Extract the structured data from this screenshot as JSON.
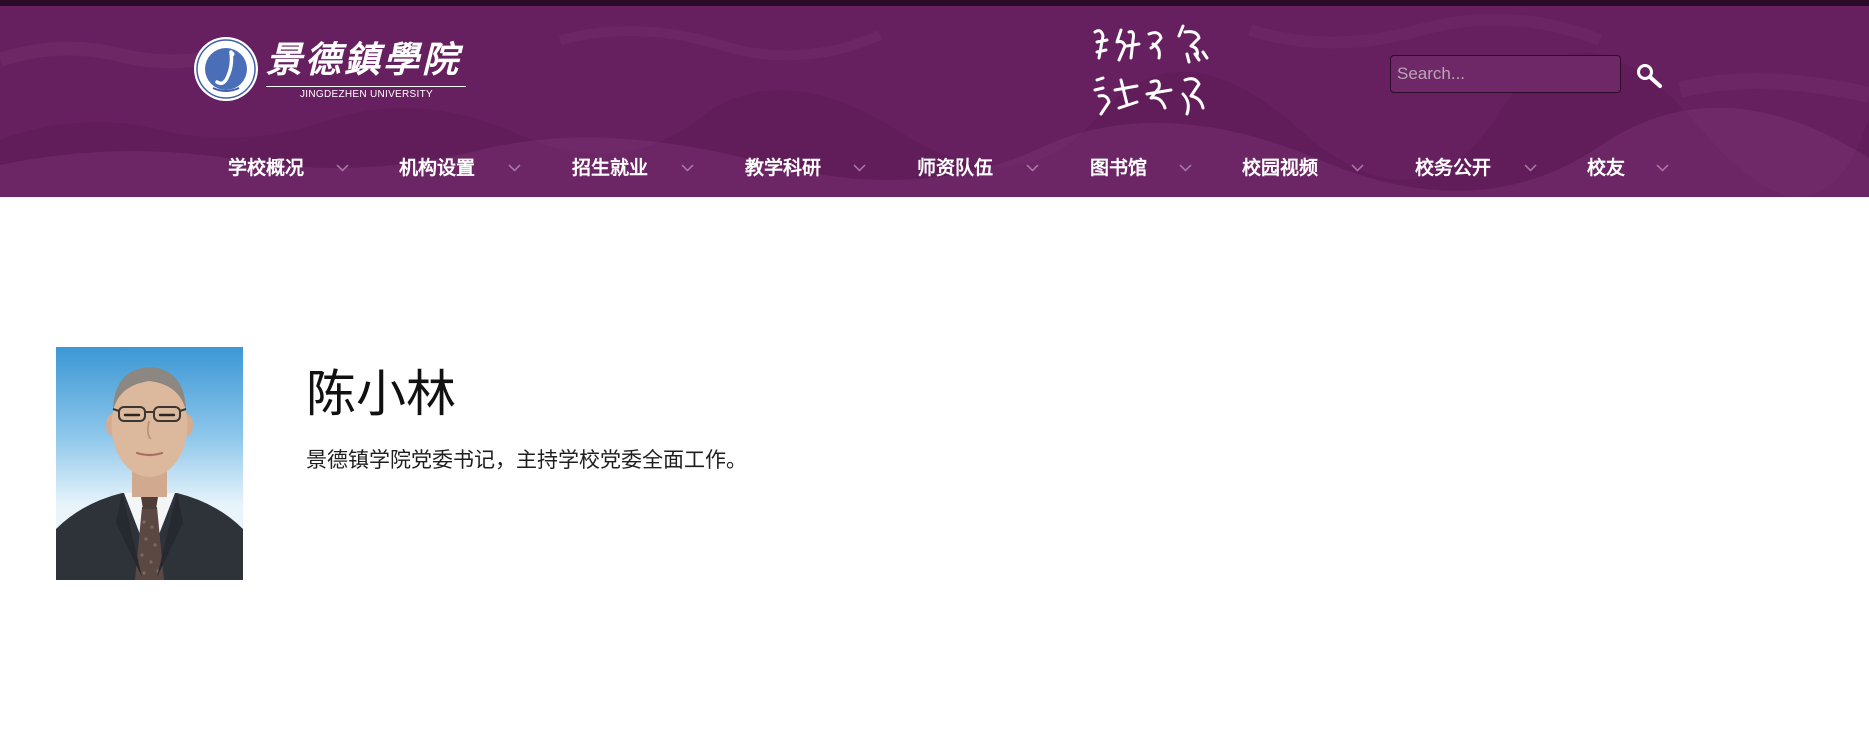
{
  "header": {
    "logo": {
      "name_cn": "景德鎮學院",
      "name_en": "JINGDEZHEN UNIVERSITY"
    },
    "search": {
      "placeholder": "Search..."
    },
    "nav": [
      {
        "label": "学校概况"
      },
      {
        "label": "机构设置"
      },
      {
        "label": "招生就业"
      },
      {
        "label": "教学科研"
      },
      {
        "label": "师资队伍"
      },
      {
        "label": "图书馆"
      },
      {
        "label": "校园视频"
      },
      {
        "label": "校务公开"
      },
      {
        "label": "校友"
      }
    ]
  },
  "profile": {
    "name": "陈小林",
    "title": "景德镇学院党委书记，主持学校党委全面工作。"
  },
  "colors": {
    "header_bg": "#661f5f",
    "top_strip": "#2b0b27",
    "nav_text": "#ffffff",
    "chevron": "#b07aa9",
    "search_bg": "#6e2868"
  },
  "icons": {
    "search": "search-icon",
    "nav_dropdown": "chevron-down-icon",
    "logo": "university-emblem-icon"
  }
}
